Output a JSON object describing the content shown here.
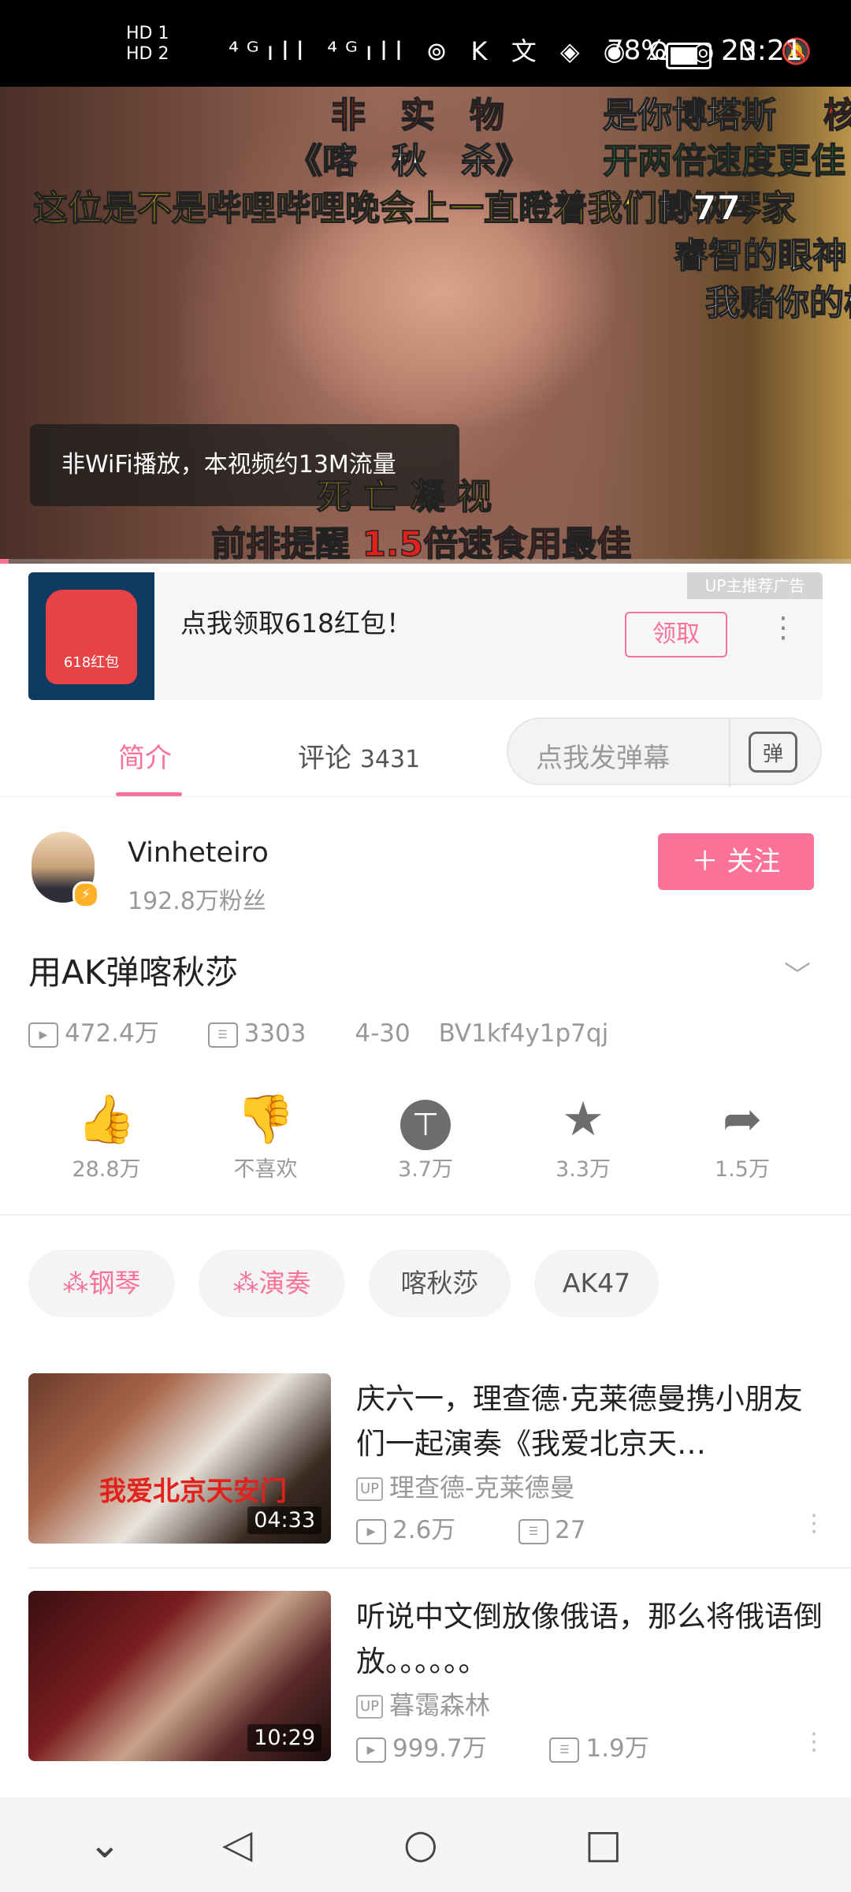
{
  "status_bar": {
    "left_labels": [
      "HD 1",
      "HD 2"
    ],
    "icons_text": "⁴ᴳıll ⁴ᴳıll ⊚ K 文 ◈ ◉ Ω ◎ N 🔕",
    "battery": "78%",
    "time": "23:21"
  },
  "player": {
    "danmaku": [
      {
        "text": "非　实　物",
        "color": "red"
      },
      {
        "text": "是你博塔斯",
        "color": "white"
      },
      {
        "text": "核",
        "color": "red"
      },
      {
        "text": "《喀　秋　杀》",
        "color": "white"
      },
      {
        "text": "开两倍速度更佳",
        "color": "green"
      },
      {
        "text": "这位是不是哔哩哔哩晚会上一直瞪着我们的钢琴家",
        "color": "yellow"
      },
      {
        "text": "博77",
        "color": "white"
      },
      {
        "text": "睿智的眼神",
        "color": "white"
      },
      {
        "text": "我赌你的枪",
        "color": "white"
      },
      {
        "text": "死 亡 凝 视",
        "color": "yellow"
      },
      {
        "text": "前排提醒 1.5倍速食用最佳",
        "color": "red"
      }
    ],
    "toast": "非WiFi播放，本视频约13M流量",
    "progress_fraction": 0.01
  },
  "ad": {
    "thumb_label": "618红包",
    "tag": "UP主推荐广告",
    "title": "点我领取618红包！",
    "button": "领取"
  },
  "tabs": {
    "intro": "简介",
    "comments": "评论",
    "comment_count": "3431",
    "danmaku_placeholder": "点我发弹幕",
    "danmaku_icon_text": "弹"
  },
  "uploader": {
    "name": "Vinheteiro",
    "fans": "192.8万粉丝",
    "follow": "＋ 关注"
  },
  "video": {
    "title": "用AK弹喀秋莎",
    "views": "472.4万",
    "danmaku_count": "3303",
    "date": "4-30",
    "bvid": "BV1kf4y1p7qj"
  },
  "actions": [
    {
      "icon": "thumbs-up-icon",
      "glyph": "👍",
      "label": "28.8万"
    },
    {
      "icon": "thumbs-down-icon",
      "glyph": "👎",
      "label": "不喜欢"
    },
    {
      "icon": "coin-icon",
      "glyph": "⊤",
      "label": "3.7万"
    },
    {
      "icon": "star-icon",
      "glyph": "★",
      "label": "3.3万"
    },
    {
      "icon": "share-icon",
      "glyph": "➦",
      "label": "1.5万"
    }
  ],
  "tags": [
    {
      "label": "钢琴",
      "channel": true
    },
    {
      "label": "演奏",
      "channel": true
    },
    {
      "label": "喀秋莎",
      "channel": false
    },
    {
      "label": "AK47",
      "channel": false
    }
  ],
  "related": [
    {
      "title": "庆六一，理查德·克莱德曼携小朋友们一起演奏《我爱北京天…",
      "uploader": "理查德-克莱德曼",
      "views": "2.6万",
      "danmaku": "27",
      "duration": "04:33",
      "thumb_caption": "我爱北京天安门"
    },
    {
      "title": "听说中文倒放像俄语，那么将俄语倒放。。。。。。",
      "uploader": "暮霭森林",
      "views": "999.7万",
      "danmaku": "1.9万",
      "duration": "10:29"
    }
  ],
  "navbar": {
    "down": "⌄",
    "back": "◁",
    "home": "○",
    "recent": "□"
  },
  "colors": {
    "accent": "#fb7299"
  }
}
